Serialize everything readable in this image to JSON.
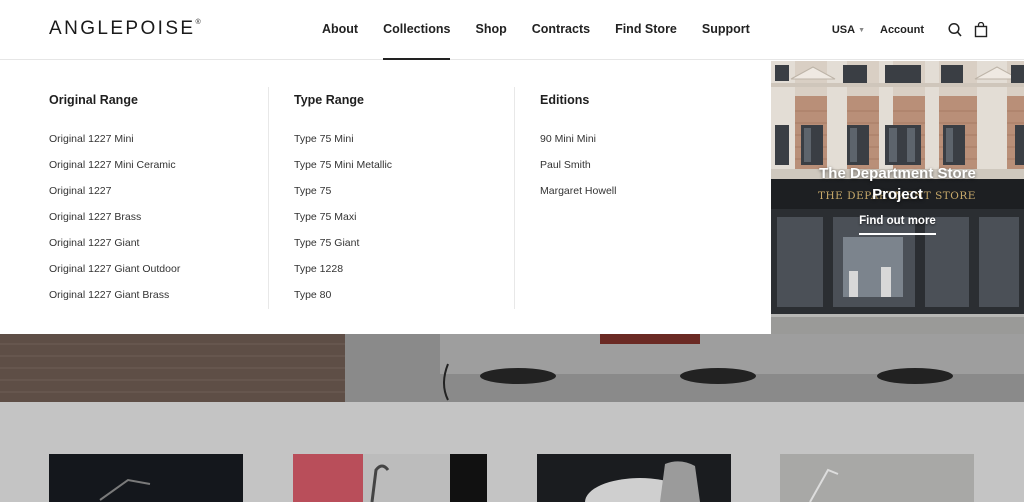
{
  "brand": {
    "name": "ANGLEPOISE",
    "mark": "®"
  },
  "nav": [
    "About",
    "Collections",
    "Shop",
    "Contracts",
    "Find Store",
    "Support"
  ],
  "utility": {
    "region": "USA",
    "account": "Account"
  },
  "menu": {
    "columns": [
      {
        "title": "Original Range",
        "items": [
          "Original 1227 Mini",
          "Original 1227 Mini Ceramic",
          "Original 1227",
          "Original 1227 Brass",
          "Original 1227 Giant",
          "Original 1227 Giant Outdoor",
          "Original 1227 Giant Brass"
        ]
      },
      {
        "title": "Type Range",
        "items": [
          "Type 75 Mini",
          "Type 75 Mini Metallic",
          "Type 75",
          "Type 75 Maxi",
          "Type 75 Giant",
          "Type 1228",
          "Type 80"
        ]
      },
      {
        "title": "Editions",
        "items": [
          "90 Mini Mini",
          "Paul Smith",
          "Margaret Howell"
        ]
      }
    ]
  },
  "promo": {
    "title_line1": "The Department Store",
    "title_line2": "Project",
    "link": "Find out more",
    "signage": "THE DEPARTMENT STORE"
  },
  "colors": {
    "accent": "#222222",
    "bg_dim": "#c4c4c4"
  }
}
